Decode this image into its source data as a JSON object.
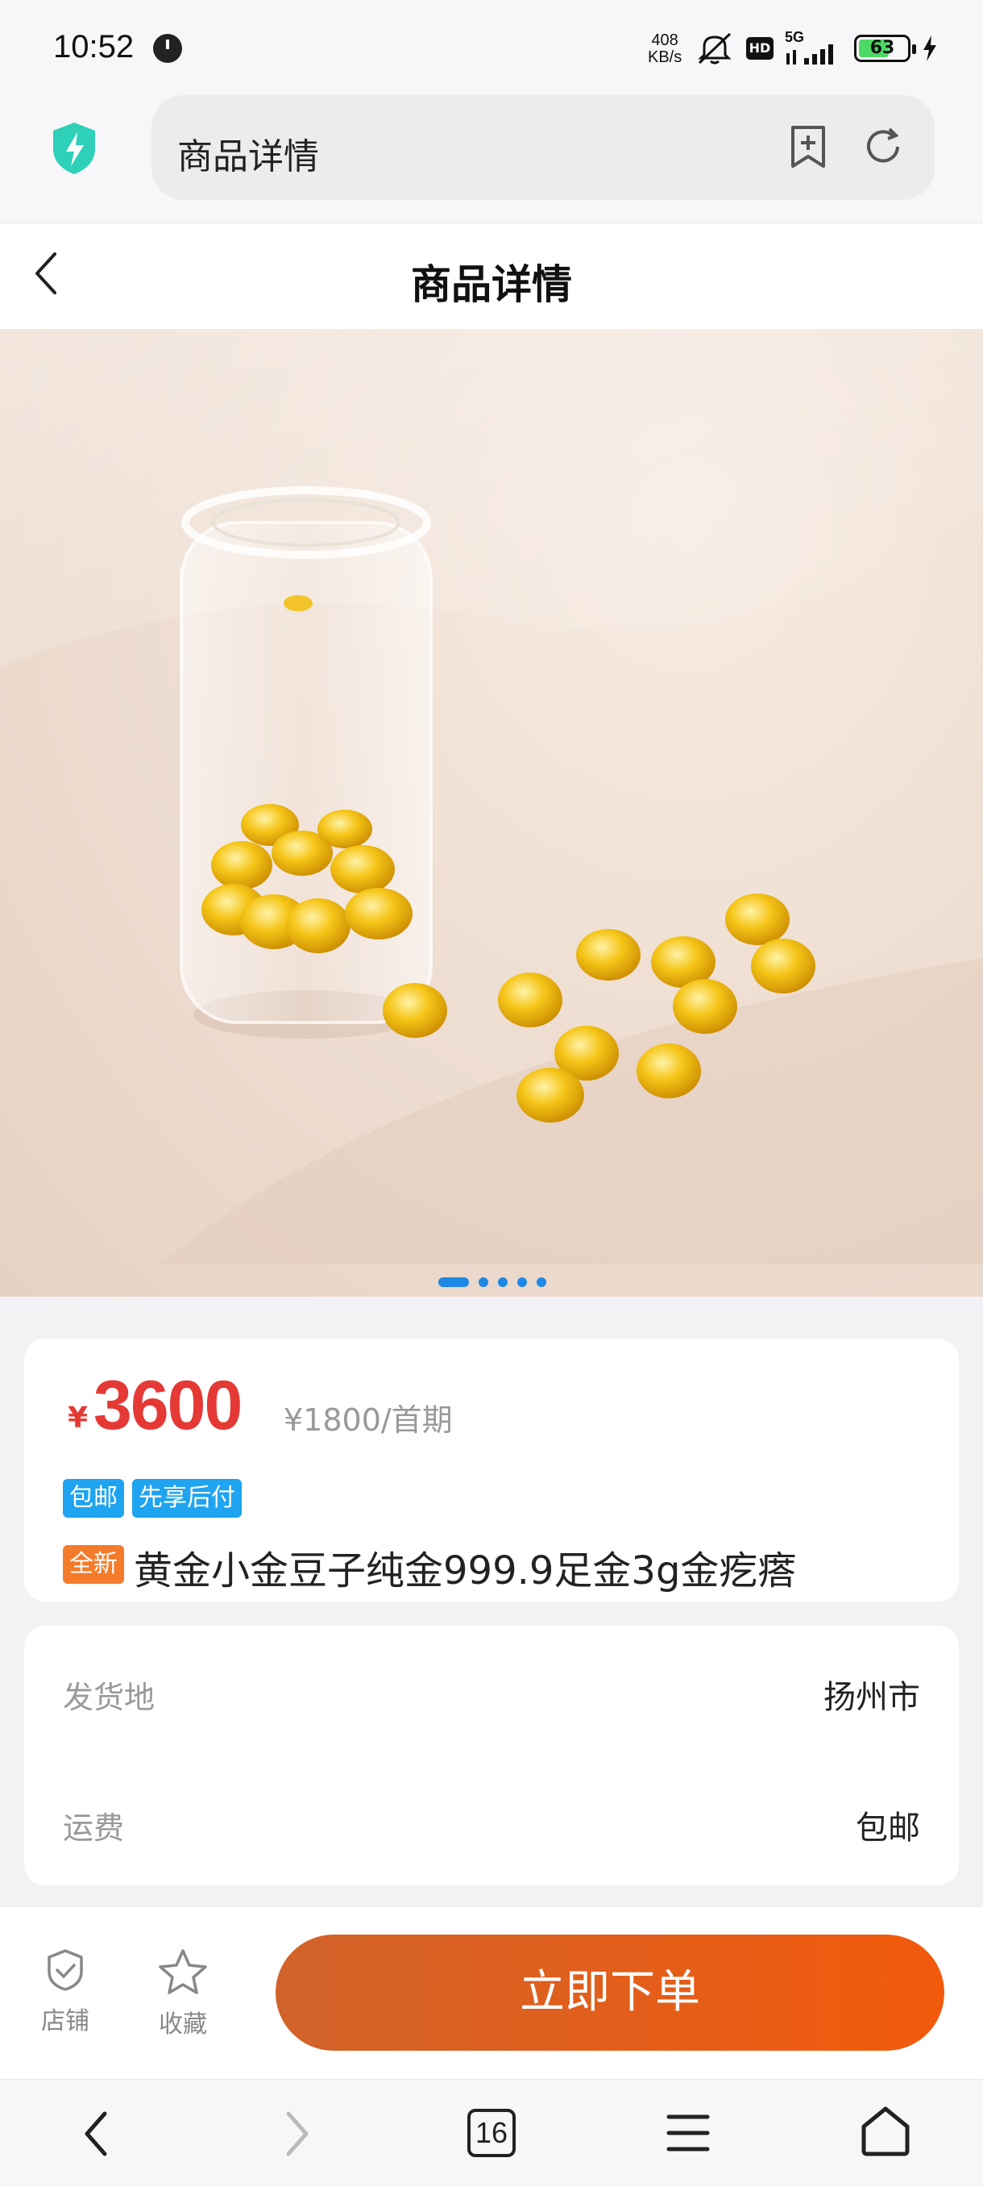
{
  "status": {
    "time": "10:52",
    "net_speed_top": "408",
    "net_speed_bottom": "KB/s",
    "hd": "HD",
    "signal": "5G",
    "battery": "63",
    "battery_level": 0.63
  },
  "browser": {
    "url_title": "商品详情"
  },
  "header": {
    "title": "商品详情"
  },
  "gallery": {
    "slides": 5,
    "active_index": 0
  },
  "product": {
    "currency": "¥",
    "price": "3600",
    "installment": "¥1800/首期",
    "tags": [
      "包邮",
      "先享后付"
    ],
    "condition_tag": "全新",
    "title": "黄金小金豆子纯金999.9足金3g金疙瘩"
  },
  "shipping": {
    "origin_label": "发货地",
    "origin_value": "扬州市",
    "fee_label": "运费",
    "fee_value": "包邮"
  },
  "actions": {
    "shop_label": "店铺",
    "fav_label": "收藏",
    "buy_label": "立即下单"
  },
  "nav": {
    "tabs_count": "16"
  },
  "colors": {
    "price_red": "#e53935",
    "tag_blue": "#1ea4f0",
    "tag_orange": "#f47b2a",
    "buy_gradient_start": "#d1632a",
    "buy_gradient_end": "#f25a0c"
  }
}
